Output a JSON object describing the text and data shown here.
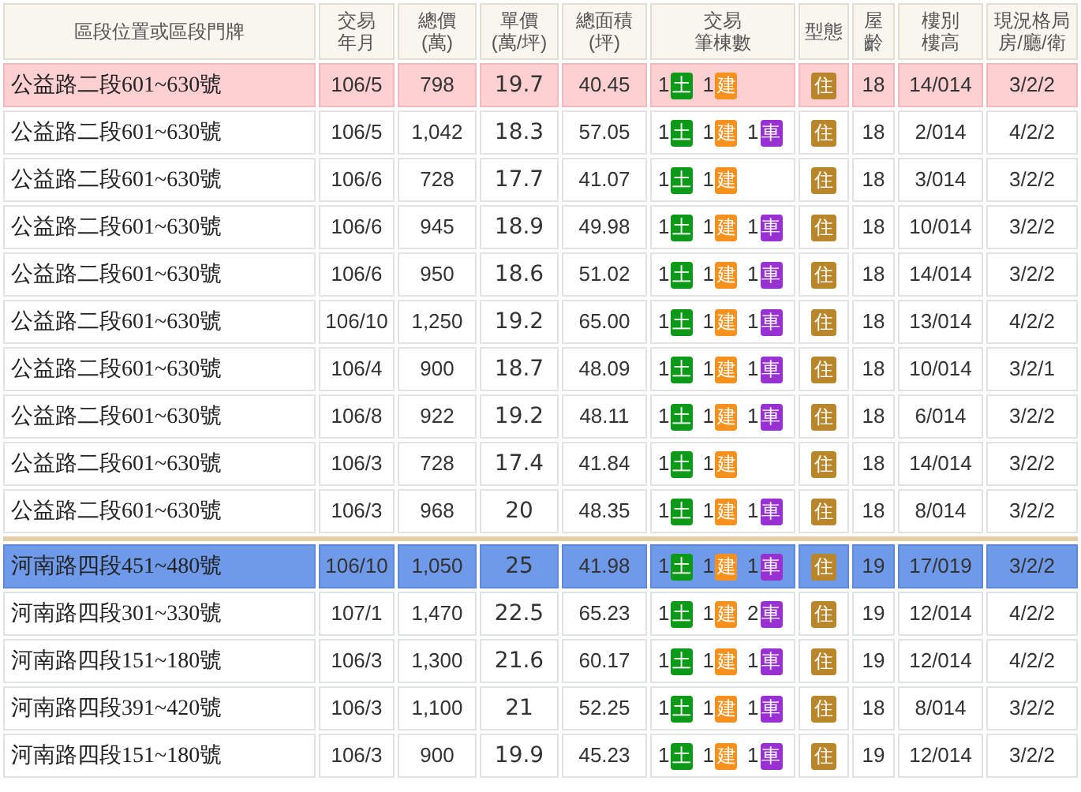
{
  "columns": [
    [
      "區段位置或區段門牌"
    ],
    [
      "交易",
      "年月"
    ],
    [
      "總價",
      "(萬)"
    ],
    [
      "單價",
      "(萬/坪)"
    ],
    [
      "總面積",
      "(坪)"
    ],
    [
      "交易",
      "筆棟數"
    ],
    [
      "型態"
    ],
    [
      "屋",
      "齡"
    ],
    [
      "樓別",
      "樓高"
    ],
    [
      "現況格局",
      "房/廳/衛"
    ]
  ],
  "rows": [
    {
      "kind": "subject",
      "address": "公益路二段601~630號",
      "date": "106/5",
      "total": "798",
      "unit": "19.7",
      "area": "40.45",
      "parcels": [
        {
          "count": "1",
          "label": "土",
          "kind": "land"
        },
        {
          "count": "1",
          "label": "建",
          "kind": "building"
        }
      ],
      "type": "住",
      "age": "18",
      "floor": "14/014",
      "layout": "3/2/2"
    },
    {
      "kind": "normal",
      "address": "公益路二段601~630號",
      "date": "106/5",
      "total": "1,042",
      "unit": "18.3",
      "area": "57.05",
      "parcels": [
        {
          "count": "1",
          "label": "土",
          "kind": "land"
        },
        {
          "count": "1",
          "label": "建",
          "kind": "building"
        },
        {
          "count": "1",
          "label": "車",
          "kind": "parking"
        }
      ],
      "type": "住",
      "age": "18",
      "floor": "2/014",
      "layout": "4/2/2"
    },
    {
      "kind": "normal",
      "address": "公益路二段601~630號",
      "date": "106/6",
      "total": "728",
      "unit": "17.7",
      "area": "41.07",
      "parcels": [
        {
          "count": "1",
          "label": "土",
          "kind": "land"
        },
        {
          "count": "1",
          "label": "建",
          "kind": "building"
        }
      ],
      "type": "住",
      "age": "18",
      "floor": "3/014",
      "layout": "3/2/2"
    },
    {
      "kind": "normal",
      "address": "公益路二段601~630號",
      "date": "106/6",
      "total": "945",
      "unit": "18.9",
      "area": "49.98",
      "parcels": [
        {
          "count": "1",
          "label": "土",
          "kind": "land"
        },
        {
          "count": "1",
          "label": "建",
          "kind": "building"
        },
        {
          "count": "1",
          "label": "車",
          "kind": "parking"
        }
      ],
      "type": "住",
      "age": "18",
      "floor": "10/014",
      "layout": "3/2/2"
    },
    {
      "kind": "normal",
      "address": "公益路二段601~630號",
      "date": "106/6",
      "total": "950",
      "unit": "18.6",
      "area": "51.02",
      "parcels": [
        {
          "count": "1",
          "label": "土",
          "kind": "land"
        },
        {
          "count": "1",
          "label": "建",
          "kind": "building"
        },
        {
          "count": "1",
          "label": "車",
          "kind": "parking"
        }
      ],
      "type": "住",
      "age": "18",
      "floor": "14/014",
      "layout": "3/2/2"
    },
    {
      "kind": "normal",
      "address": "公益路二段601~630號",
      "date": "106/10",
      "total": "1,250",
      "unit": "19.2",
      "area": "65.00",
      "parcels": [
        {
          "count": "1",
          "label": "土",
          "kind": "land"
        },
        {
          "count": "1",
          "label": "建",
          "kind": "building"
        },
        {
          "count": "1",
          "label": "車",
          "kind": "parking"
        }
      ],
      "type": "住",
      "age": "18",
      "floor": "13/014",
      "layout": "4/2/2"
    },
    {
      "kind": "normal",
      "address": "公益路二段601~630號",
      "date": "106/4",
      "total": "900",
      "unit": "18.7",
      "area": "48.09",
      "parcels": [
        {
          "count": "1",
          "label": "土",
          "kind": "land"
        },
        {
          "count": "1",
          "label": "建",
          "kind": "building"
        },
        {
          "count": "1",
          "label": "車",
          "kind": "parking"
        }
      ],
      "type": "住",
      "age": "18",
      "floor": "10/014",
      "layout": "3/2/1"
    },
    {
      "kind": "normal",
      "address": "公益路二段601~630號",
      "date": "106/8",
      "total": "922",
      "unit": "19.2",
      "area": "48.11",
      "parcels": [
        {
          "count": "1",
          "label": "土",
          "kind": "land"
        },
        {
          "count": "1",
          "label": "建",
          "kind": "building"
        },
        {
          "count": "1",
          "label": "車",
          "kind": "parking"
        }
      ],
      "type": "住",
      "age": "18",
      "floor": "6/014",
      "layout": "3/2/2"
    },
    {
      "kind": "normal",
      "address": "公益路二段601~630號",
      "date": "106/3",
      "total": "728",
      "unit": "17.4",
      "area": "41.84",
      "parcels": [
        {
          "count": "1",
          "label": "土",
          "kind": "land"
        },
        {
          "count": "1",
          "label": "建",
          "kind": "building"
        }
      ],
      "type": "住",
      "age": "18",
      "floor": "14/014",
      "layout": "3/2/2"
    },
    {
      "kind": "normal",
      "address": "公益路二段601~630號",
      "date": "106/3",
      "total": "968",
      "unit": "20",
      "area": "48.35",
      "parcels": [
        {
          "count": "1",
          "label": "土",
          "kind": "land"
        },
        {
          "count": "1",
          "label": "建",
          "kind": "building"
        },
        {
          "count": "1",
          "label": "車",
          "kind": "parking"
        }
      ],
      "type": "住",
      "age": "18",
      "floor": "8/014",
      "layout": "3/2/2"
    },
    {
      "kind": "selected",
      "address": "河南路四段451~480號",
      "date": "106/10",
      "total": "1,050",
      "unit": "25",
      "area": "41.98",
      "parcels": [
        {
          "count": "1",
          "label": "土",
          "kind": "land"
        },
        {
          "count": "1",
          "label": "建",
          "kind": "building"
        },
        {
          "count": "1",
          "label": "車",
          "kind": "parking"
        }
      ],
      "type": "住",
      "age": "19",
      "floor": "17/019",
      "layout": "3/2/2"
    },
    {
      "kind": "normal",
      "address": "河南路四段301~330號",
      "date": "107/1",
      "total": "1,470",
      "unit": "22.5",
      "area": "65.23",
      "parcels": [
        {
          "count": "1",
          "label": "土",
          "kind": "land"
        },
        {
          "count": "1",
          "label": "建",
          "kind": "building"
        },
        {
          "count": "2",
          "label": "車",
          "kind": "parking"
        }
      ],
      "type": "住",
      "age": "19",
      "floor": "12/014",
      "layout": "4/2/2"
    },
    {
      "kind": "normal",
      "address": "河南路四段151~180號",
      "date": "106/3",
      "total": "1,300",
      "unit": "21.6",
      "area": "60.17",
      "parcels": [
        {
          "count": "1",
          "label": "土",
          "kind": "land"
        },
        {
          "count": "1",
          "label": "建",
          "kind": "building"
        },
        {
          "count": "1",
          "label": "車",
          "kind": "parking"
        }
      ],
      "type": "住",
      "age": "19",
      "floor": "12/014",
      "layout": "4/2/2"
    },
    {
      "kind": "normal",
      "address": "河南路四段391~420號",
      "date": "106/3",
      "total": "1,100",
      "unit": "21",
      "area": "52.25",
      "parcels": [
        {
          "count": "1",
          "label": "土",
          "kind": "land"
        },
        {
          "count": "1",
          "label": "建",
          "kind": "building"
        },
        {
          "count": "1",
          "label": "車",
          "kind": "parking"
        }
      ],
      "type": "住",
      "age": "18",
      "floor": "8/014",
      "layout": "3/2/2"
    },
    {
      "kind": "normal",
      "address": "河南路四段151~180號",
      "date": "106/3",
      "total": "900",
      "unit": "19.9",
      "area": "45.23",
      "parcels": [
        {
          "count": "1",
          "label": "土",
          "kind": "land"
        },
        {
          "count": "1",
          "label": "建",
          "kind": "building"
        },
        {
          "count": "1",
          "label": "車",
          "kind": "parking"
        }
      ],
      "type": "住",
      "age": "19",
      "floor": "12/014",
      "layout": "3/2/2"
    }
  ]
}
